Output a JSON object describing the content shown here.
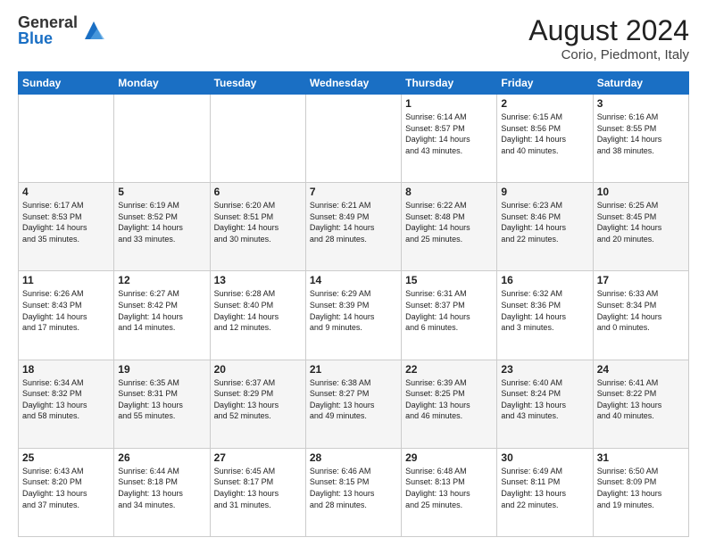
{
  "logo": {
    "general": "General",
    "blue": "Blue"
  },
  "header": {
    "month_year": "August 2024",
    "location": "Corio, Piedmont, Italy"
  },
  "days_of_week": [
    "Sunday",
    "Monday",
    "Tuesday",
    "Wednesday",
    "Thursday",
    "Friday",
    "Saturday"
  ],
  "weeks": [
    [
      {
        "day": "",
        "info": ""
      },
      {
        "day": "",
        "info": ""
      },
      {
        "day": "",
        "info": ""
      },
      {
        "day": "",
        "info": ""
      },
      {
        "day": "1",
        "info": "Sunrise: 6:14 AM\nSunset: 8:57 PM\nDaylight: 14 hours\nand 43 minutes."
      },
      {
        "day": "2",
        "info": "Sunrise: 6:15 AM\nSunset: 8:56 PM\nDaylight: 14 hours\nand 40 minutes."
      },
      {
        "day": "3",
        "info": "Sunrise: 6:16 AM\nSunset: 8:55 PM\nDaylight: 14 hours\nand 38 minutes."
      }
    ],
    [
      {
        "day": "4",
        "info": "Sunrise: 6:17 AM\nSunset: 8:53 PM\nDaylight: 14 hours\nand 35 minutes."
      },
      {
        "day": "5",
        "info": "Sunrise: 6:19 AM\nSunset: 8:52 PM\nDaylight: 14 hours\nand 33 minutes."
      },
      {
        "day": "6",
        "info": "Sunrise: 6:20 AM\nSunset: 8:51 PM\nDaylight: 14 hours\nand 30 minutes."
      },
      {
        "day": "7",
        "info": "Sunrise: 6:21 AM\nSunset: 8:49 PM\nDaylight: 14 hours\nand 28 minutes."
      },
      {
        "day": "8",
        "info": "Sunrise: 6:22 AM\nSunset: 8:48 PM\nDaylight: 14 hours\nand 25 minutes."
      },
      {
        "day": "9",
        "info": "Sunrise: 6:23 AM\nSunset: 8:46 PM\nDaylight: 14 hours\nand 22 minutes."
      },
      {
        "day": "10",
        "info": "Sunrise: 6:25 AM\nSunset: 8:45 PM\nDaylight: 14 hours\nand 20 minutes."
      }
    ],
    [
      {
        "day": "11",
        "info": "Sunrise: 6:26 AM\nSunset: 8:43 PM\nDaylight: 14 hours\nand 17 minutes."
      },
      {
        "day": "12",
        "info": "Sunrise: 6:27 AM\nSunset: 8:42 PM\nDaylight: 14 hours\nand 14 minutes."
      },
      {
        "day": "13",
        "info": "Sunrise: 6:28 AM\nSunset: 8:40 PM\nDaylight: 14 hours\nand 12 minutes."
      },
      {
        "day": "14",
        "info": "Sunrise: 6:29 AM\nSunset: 8:39 PM\nDaylight: 14 hours\nand 9 minutes."
      },
      {
        "day": "15",
        "info": "Sunrise: 6:31 AM\nSunset: 8:37 PM\nDaylight: 14 hours\nand 6 minutes."
      },
      {
        "day": "16",
        "info": "Sunrise: 6:32 AM\nSunset: 8:36 PM\nDaylight: 14 hours\nand 3 minutes."
      },
      {
        "day": "17",
        "info": "Sunrise: 6:33 AM\nSunset: 8:34 PM\nDaylight: 14 hours\nand 0 minutes."
      }
    ],
    [
      {
        "day": "18",
        "info": "Sunrise: 6:34 AM\nSunset: 8:32 PM\nDaylight: 13 hours\nand 58 minutes."
      },
      {
        "day": "19",
        "info": "Sunrise: 6:35 AM\nSunset: 8:31 PM\nDaylight: 13 hours\nand 55 minutes."
      },
      {
        "day": "20",
        "info": "Sunrise: 6:37 AM\nSunset: 8:29 PM\nDaylight: 13 hours\nand 52 minutes."
      },
      {
        "day": "21",
        "info": "Sunrise: 6:38 AM\nSunset: 8:27 PM\nDaylight: 13 hours\nand 49 minutes."
      },
      {
        "day": "22",
        "info": "Sunrise: 6:39 AM\nSunset: 8:25 PM\nDaylight: 13 hours\nand 46 minutes."
      },
      {
        "day": "23",
        "info": "Sunrise: 6:40 AM\nSunset: 8:24 PM\nDaylight: 13 hours\nand 43 minutes."
      },
      {
        "day": "24",
        "info": "Sunrise: 6:41 AM\nSunset: 8:22 PM\nDaylight: 13 hours\nand 40 minutes."
      }
    ],
    [
      {
        "day": "25",
        "info": "Sunrise: 6:43 AM\nSunset: 8:20 PM\nDaylight: 13 hours\nand 37 minutes."
      },
      {
        "day": "26",
        "info": "Sunrise: 6:44 AM\nSunset: 8:18 PM\nDaylight: 13 hours\nand 34 minutes."
      },
      {
        "day": "27",
        "info": "Sunrise: 6:45 AM\nSunset: 8:17 PM\nDaylight: 13 hours\nand 31 minutes."
      },
      {
        "day": "28",
        "info": "Sunrise: 6:46 AM\nSunset: 8:15 PM\nDaylight: 13 hours\nand 28 minutes."
      },
      {
        "day": "29",
        "info": "Sunrise: 6:48 AM\nSunset: 8:13 PM\nDaylight: 13 hours\nand 25 minutes."
      },
      {
        "day": "30",
        "info": "Sunrise: 6:49 AM\nSunset: 8:11 PM\nDaylight: 13 hours\nand 22 minutes."
      },
      {
        "day": "31",
        "info": "Sunrise: 6:50 AM\nSunset: 8:09 PM\nDaylight: 13 hours\nand 19 minutes."
      }
    ]
  ]
}
